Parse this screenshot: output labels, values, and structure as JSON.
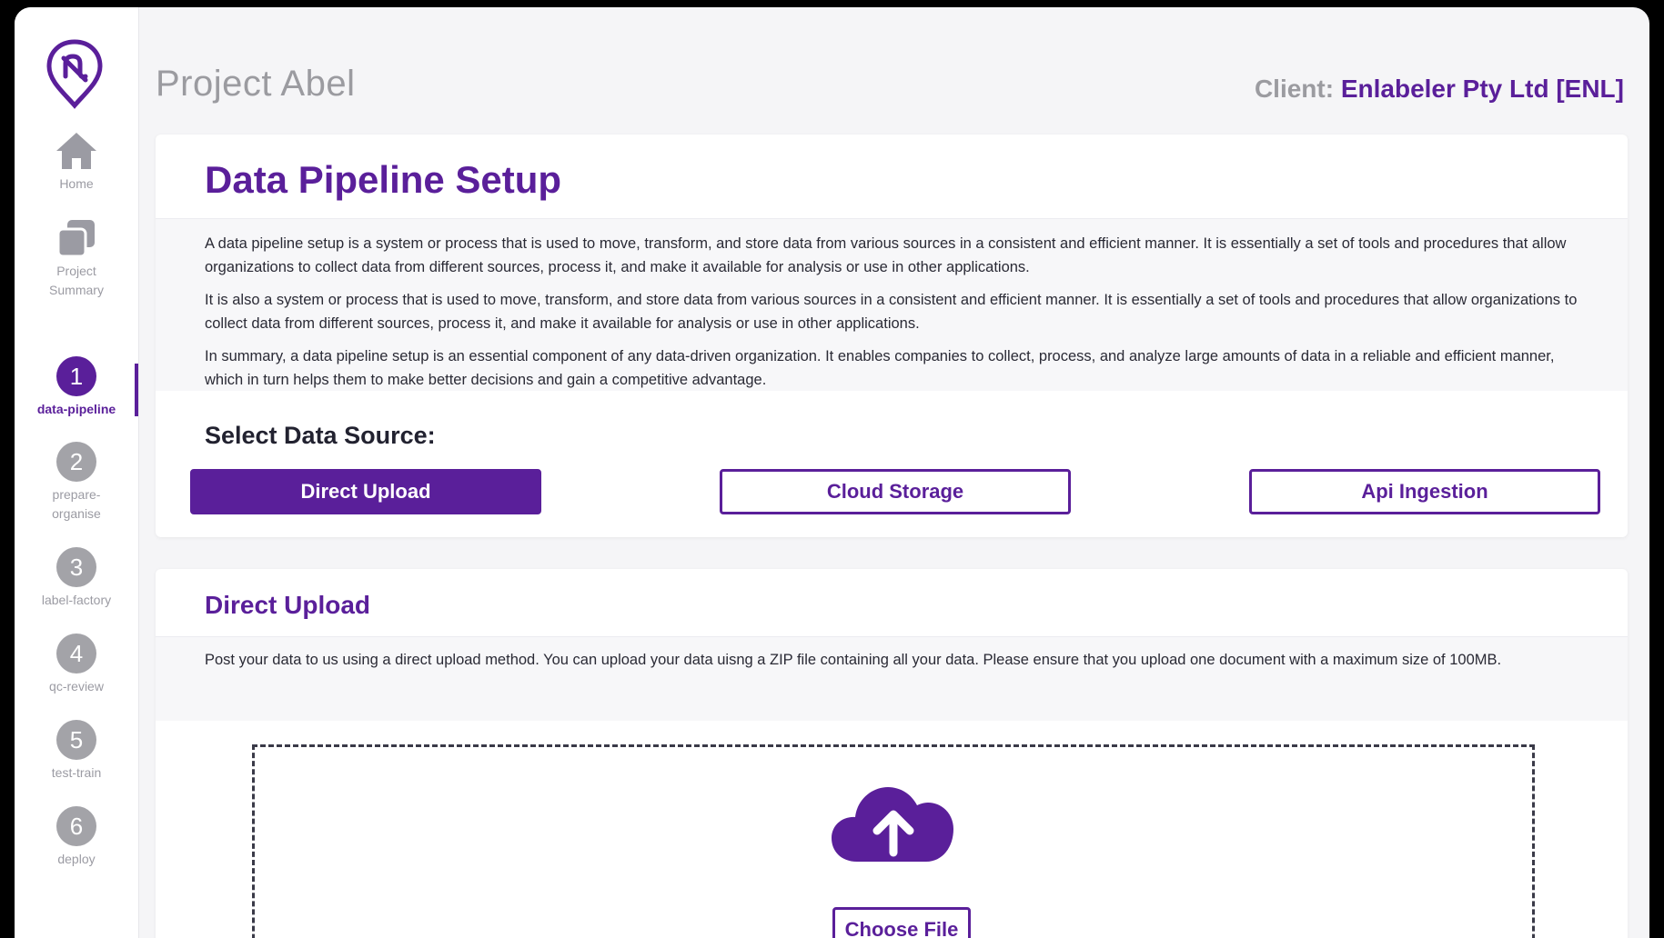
{
  "colors": {
    "accent": "#5a1f9a",
    "muted": "#9b9ba0",
    "step_inactive": "#a3a3a8"
  },
  "sidebar": {
    "logo": "enlabeler-logo",
    "items": [
      {
        "label": "Home",
        "icon": "home-icon"
      },
      {
        "label_line1": "Project",
        "label_line2": "Summary",
        "icon": "project-summary-icon"
      }
    ],
    "steps": [
      {
        "num": "1",
        "label": "data-pipeline",
        "active": true
      },
      {
        "num": "2",
        "label_line1": "prepare-",
        "label_line2": "organise"
      },
      {
        "num": "3",
        "label": "label-factory"
      },
      {
        "num": "4",
        "label": "qc-review"
      },
      {
        "num": "5",
        "label": "test-train"
      },
      {
        "num": "6",
        "label": "deploy"
      }
    ]
  },
  "header": {
    "project_title": "Project Abel",
    "client_label": "Client:",
    "client_name": "Enlabeler Pty Ltd [ENL]"
  },
  "pipeline": {
    "title": "Data Pipeline Setup",
    "paragraphs": [
      "A data pipeline setup is a system or process that is used to move, transform, and store data from various sources in a consistent and efficient manner. It is essentially a set of tools and procedures that allow organizations to collect data from different sources, process it, and make it available for analysis or use in other applications.",
      "It is also a system or process that is used to move, transform, and store data from various sources in a consistent and efficient manner. It is essentially a set of tools and procedures that allow organizations to collect data from different sources, process it, and make it available for analysis or use in other applications.",
      "In summary, a data pipeline setup is an essential component of any data-driven organization. It enables companies to collect, process, and analyze large amounts of data in a reliable and efficient manner, which in turn helps them to make better decisions and gain a competitive advantage."
    ],
    "select_label": "Select Data Source:",
    "sources": [
      "Direct Upload",
      "Cloud Storage",
      "Api Ingestion"
    ],
    "selected_source": "Direct Upload"
  },
  "upload": {
    "title": "Direct Upload",
    "description": "Post your data to us using a direct upload method. You can upload your data uisng a ZIP file containing all your data. Please ensure that you upload one document with a maximum size of 100MB.",
    "icon": "cloud-upload-icon",
    "choose_label": "Choose File"
  }
}
